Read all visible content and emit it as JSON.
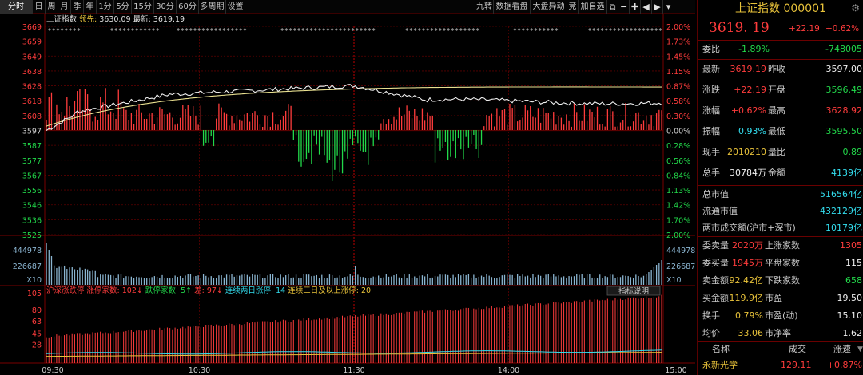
{
  "toolbar": {
    "periods": [
      "分时",
      "日",
      "周",
      "月",
      "季",
      "年",
      "1分",
      "5分",
      "15分",
      "30分",
      "60分",
      "多周期",
      "设置"
    ],
    "active": "分时",
    "right_items": [
      "九转",
      "数据看盘",
      "大盘异动",
      "竞",
      "加自选"
    ],
    "right_icons": [
      "restore-icon",
      "minus-icon",
      "plus-icon",
      "left-arrow-icon",
      "right-arrow-icon",
      "dropdown-icon"
    ]
  },
  "chart": {
    "header_name": "上证指数",
    "header_prev_label": "领先:",
    "header_prev_value": "3630.09",
    "header_last_label": "最新:",
    "header_last_value": "3619.19",
    "y_labels": [
      "3669",
      "3659",
      "3649",
      "3638",
      "3628",
      "3618",
      "3608",
      "3597",
      "3587",
      "3577",
      "3567",
      "3556",
      "3546",
      "3536",
      "3525"
    ],
    "pct_labels": [
      "2.00%",
      "1.73%",
      "1.45%",
      "1.15%",
      "0.87%",
      "0.58%",
      "0.30%",
      "0.00%",
      "0.28%",
      "0.56%",
      "0.84%",
      "1.13%",
      "1.42%",
      "1.70%",
      "2.00%"
    ],
    "vol_labels_left": [
      "444978",
      "226687",
      "X10"
    ],
    "vol_labels_right": [
      "444978",
      "226687",
      "X10"
    ],
    "indicator_line": {
      "name": "沪深涨跌停",
      "items": [
        {
          "text": "涨停家数: 102↓",
          "color": "#ff3c3c"
        },
        {
          "text": "跌停家数: 5↑",
          "color": "#22d84a"
        },
        {
          "text": "差: 97↓",
          "color": "#ff3c3c"
        },
        {
          "text": "连续两日涨停: 14",
          "color": "#33ddee"
        },
        {
          "text": "连续三日及以上涨停: 20",
          "color": "#e8c23a"
        }
      ],
      "help_button": "指标说明"
    },
    "ind_labels": [
      "105",
      "80",
      "63",
      "45",
      "28"
    ],
    "x_labels": [
      "09:30",
      "10:30",
      "11:30",
      "14:00",
      "15:00"
    ],
    "colors": {
      "up": "#ff3c3c",
      "down": "#22d84a",
      "price_line": "#f0f0f0",
      "avg_line": "#e8e090",
      "grid": "#5a0000",
      "volume": "#8ab4d0"
    }
  },
  "panel": {
    "title": "上证指数 000001",
    "price": "3619. 19",
    "change": "+22.19",
    "change_pct": "+0.62%",
    "rows1": [
      {
        "l": "委比",
        "v1": "-1.89%",
        "c1": "green",
        "v2": "-748005",
        "c2": "green"
      }
    ],
    "rows2": [
      {
        "l1": "最新",
        "v1": "3619.19",
        "c1": "red",
        "l2": "昨收",
        "v2": "3597.00",
        "c2": "white"
      },
      {
        "l1": "涨跌",
        "v1": "+22.19",
        "c1": "red",
        "l2": "开盘",
        "v2": "3596.49",
        "c2": "green"
      },
      {
        "l1": "涨幅",
        "v1": "+0.62%",
        "c1": "red",
        "l2": "最高",
        "v2": "3628.92",
        "c2": "red"
      },
      {
        "l1": "振幅",
        "v1": "0.93%",
        "c1": "cyan",
        "l2": "最低",
        "v2": "3595.50",
        "c2": "green"
      },
      {
        "l1": "现手",
        "v1": "2010210",
        "c1": "yellow",
        "l2": "量比",
        "v2": "0.89",
        "c2": "green"
      },
      {
        "l1": "总手",
        "v1": "30784万",
        "c1": "white",
        "l2": "金额",
        "v2": "4139亿",
        "c2": "cyan"
      }
    ],
    "rows3": [
      {
        "l": "总市值",
        "v": "516564亿",
        "c": "cyan"
      },
      {
        "l": "流通市值",
        "v": "432129亿",
        "c": "cyan"
      },
      {
        "l": "两市成交额(沪市+深市)",
        "v": "10179亿",
        "c": "cyan"
      }
    ],
    "rows4": [
      {
        "l1": "委卖量",
        "v1": "2020万",
        "c1": "red",
        "l2": "上涨家数",
        "v2": "1305",
        "c2": "red"
      },
      {
        "l1": "委买量",
        "v1": "1945万",
        "c1": "red",
        "l2": "平盘家数",
        "v2": "115",
        "c2": "white"
      },
      {
        "l1": "卖金额",
        "v1": "92.42亿",
        "c1": "yellow",
        "l2": "下跌家数",
        "v2": "658",
        "c2": "green"
      },
      {
        "l1": "买金额",
        "v1": "119.9亿",
        "c1": "yellow",
        "l2": "市盈",
        "v2": "19.50",
        "c2": "white"
      },
      {
        "l1": "换手",
        "v1": "0.79%",
        "c1": "yellow",
        "l2": "市盈(动)",
        "v2": "15.10",
        "c2": "white"
      },
      {
        "l1": "均价",
        "v1": "33.06",
        "c1": "yellow",
        "l2": "市净率",
        "v2": "1.62",
        "c2": "white"
      }
    ],
    "list_header": [
      "名称",
      "成交",
      "涨速"
    ],
    "list_row": {
      "name": "永新光学",
      "price": "129.11",
      "speed": "+0.87%"
    }
  }
}
